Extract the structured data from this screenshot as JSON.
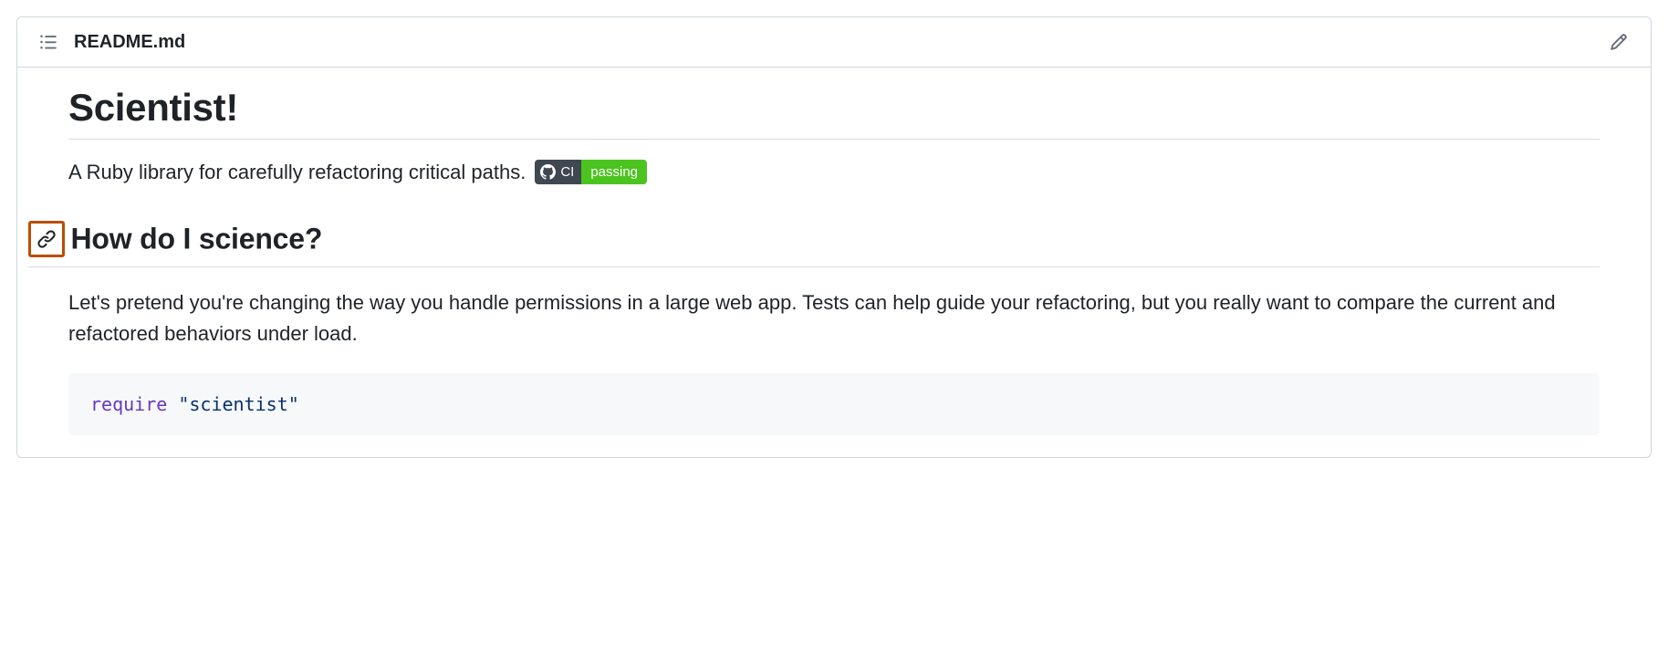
{
  "file": {
    "name": "README.md"
  },
  "content": {
    "title": "Scientist!",
    "description": "A Ruby library for carefully refactoring critical paths.",
    "badge": {
      "left_label": "CI",
      "right_label": "passing"
    },
    "section_heading": "How do I science?",
    "section_paragraph": "Let's pretend you're changing the way you handle permissions in a large web app. Tests can help guide your refactoring, but you really want to compare the current and refactored behaviors under load.",
    "code": {
      "keyword": "require",
      "string": "\"scientist\""
    }
  }
}
